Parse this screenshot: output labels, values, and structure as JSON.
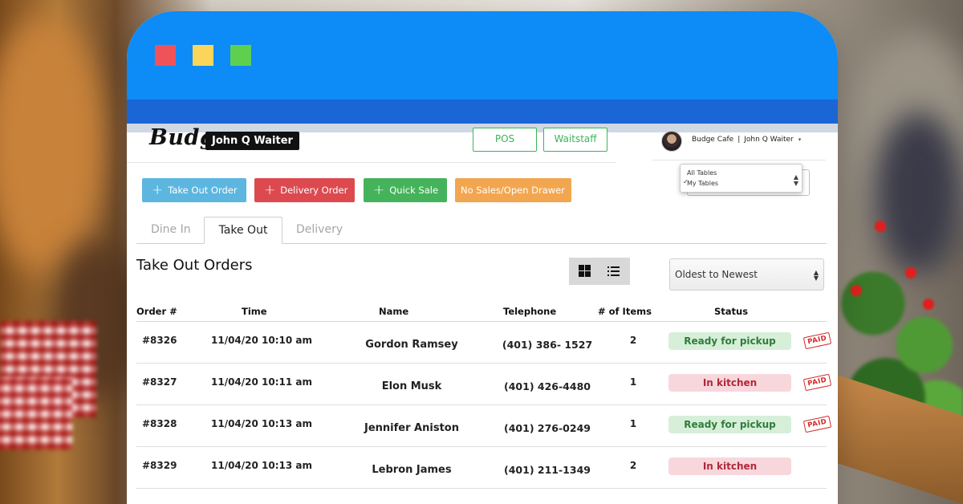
{
  "window": {
    "traffic_lights": [
      "close",
      "minimize",
      "maximize"
    ]
  },
  "header": {
    "logo": "Budge",
    "user_badge": "John Q Waiter",
    "nav": {
      "pos": "POS",
      "waitstaff": "Waitstaff"
    },
    "account": {
      "cafe": "Budge Cafe",
      "separator": "|",
      "user": "John Q Waiter",
      "caret": "▾"
    },
    "table_filter": {
      "options": [
        "All Tables",
        "My Tables"
      ],
      "selected": "My Tables",
      "check": "✓"
    }
  },
  "actions": {
    "plus": "+",
    "take_out": "Take Out Order",
    "delivery": "Delivery Order",
    "quick_sale": "Quick Sale",
    "no_sales": "No Sales/Open Drawer"
  },
  "tabs": {
    "dine_in": "Dine In",
    "take_out": "Take Out",
    "delivery": "Delivery",
    "active": "Take Out"
  },
  "section": {
    "title": "Take Out Orders",
    "view_mode": "grid"
  },
  "sort": {
    "selected": "Oldest to Newest"
  },
  "table": {
    "headers": {
      "order": "Order #",
      "time": "Time",
      "name": "Name",
      "telephone": "Telephone",
      "items": "# of Items",
      "status": "Status"
    },
    "rows": [
      {
        "order": "#8326",
        "time": "11/04/20 10:10 am",
        "name": "Gordon Ramsey",
        "telephone": "(401) 386- 1527",
        "items": "2",
        "status": "Ready for pickup",
        "paid": "PAID"
      },
      {
        "order": "#8327",
        "time": "11/04/20 10:11 am",
        "name": "Elon Musk",
        "telephone": "(401) 426-4480",
        "items": "1",
        "status": "In kitchen",
        "paid": "PAID"
      },
      {
        "order": "#8328",
        "time": "11/04/20 10:13 am",
        "name": "Jennifer Aniston",
        "telephone": "(401) 276-0249",
        "items": "1",
        "status": "Ready for pickup",
        "paid": "PAID"
      },
      {
        "order": "#8329",
        "time": "11/04/20 10:13 am",
        "name": "Lebron James",
        "telephone": "(401) 211-1349",
        "items": "2",
        "status": "In kitchen",
        "paid": ""
      }
    ]
  },
  "colors": {
    "titlebar": "#0d8bf6",
    "take_out_btn": "#5cb6df",
    "delivery_btn": "#dc4a4f",
    "quick_sale_btn": "#45b35b",
    "no_sales_btn": "#f2a650",
    "ready": "#d7efd9",
    "kitchen": "#f8d7dc",
    "nav_outline": "#3cb45a"
  }
}
